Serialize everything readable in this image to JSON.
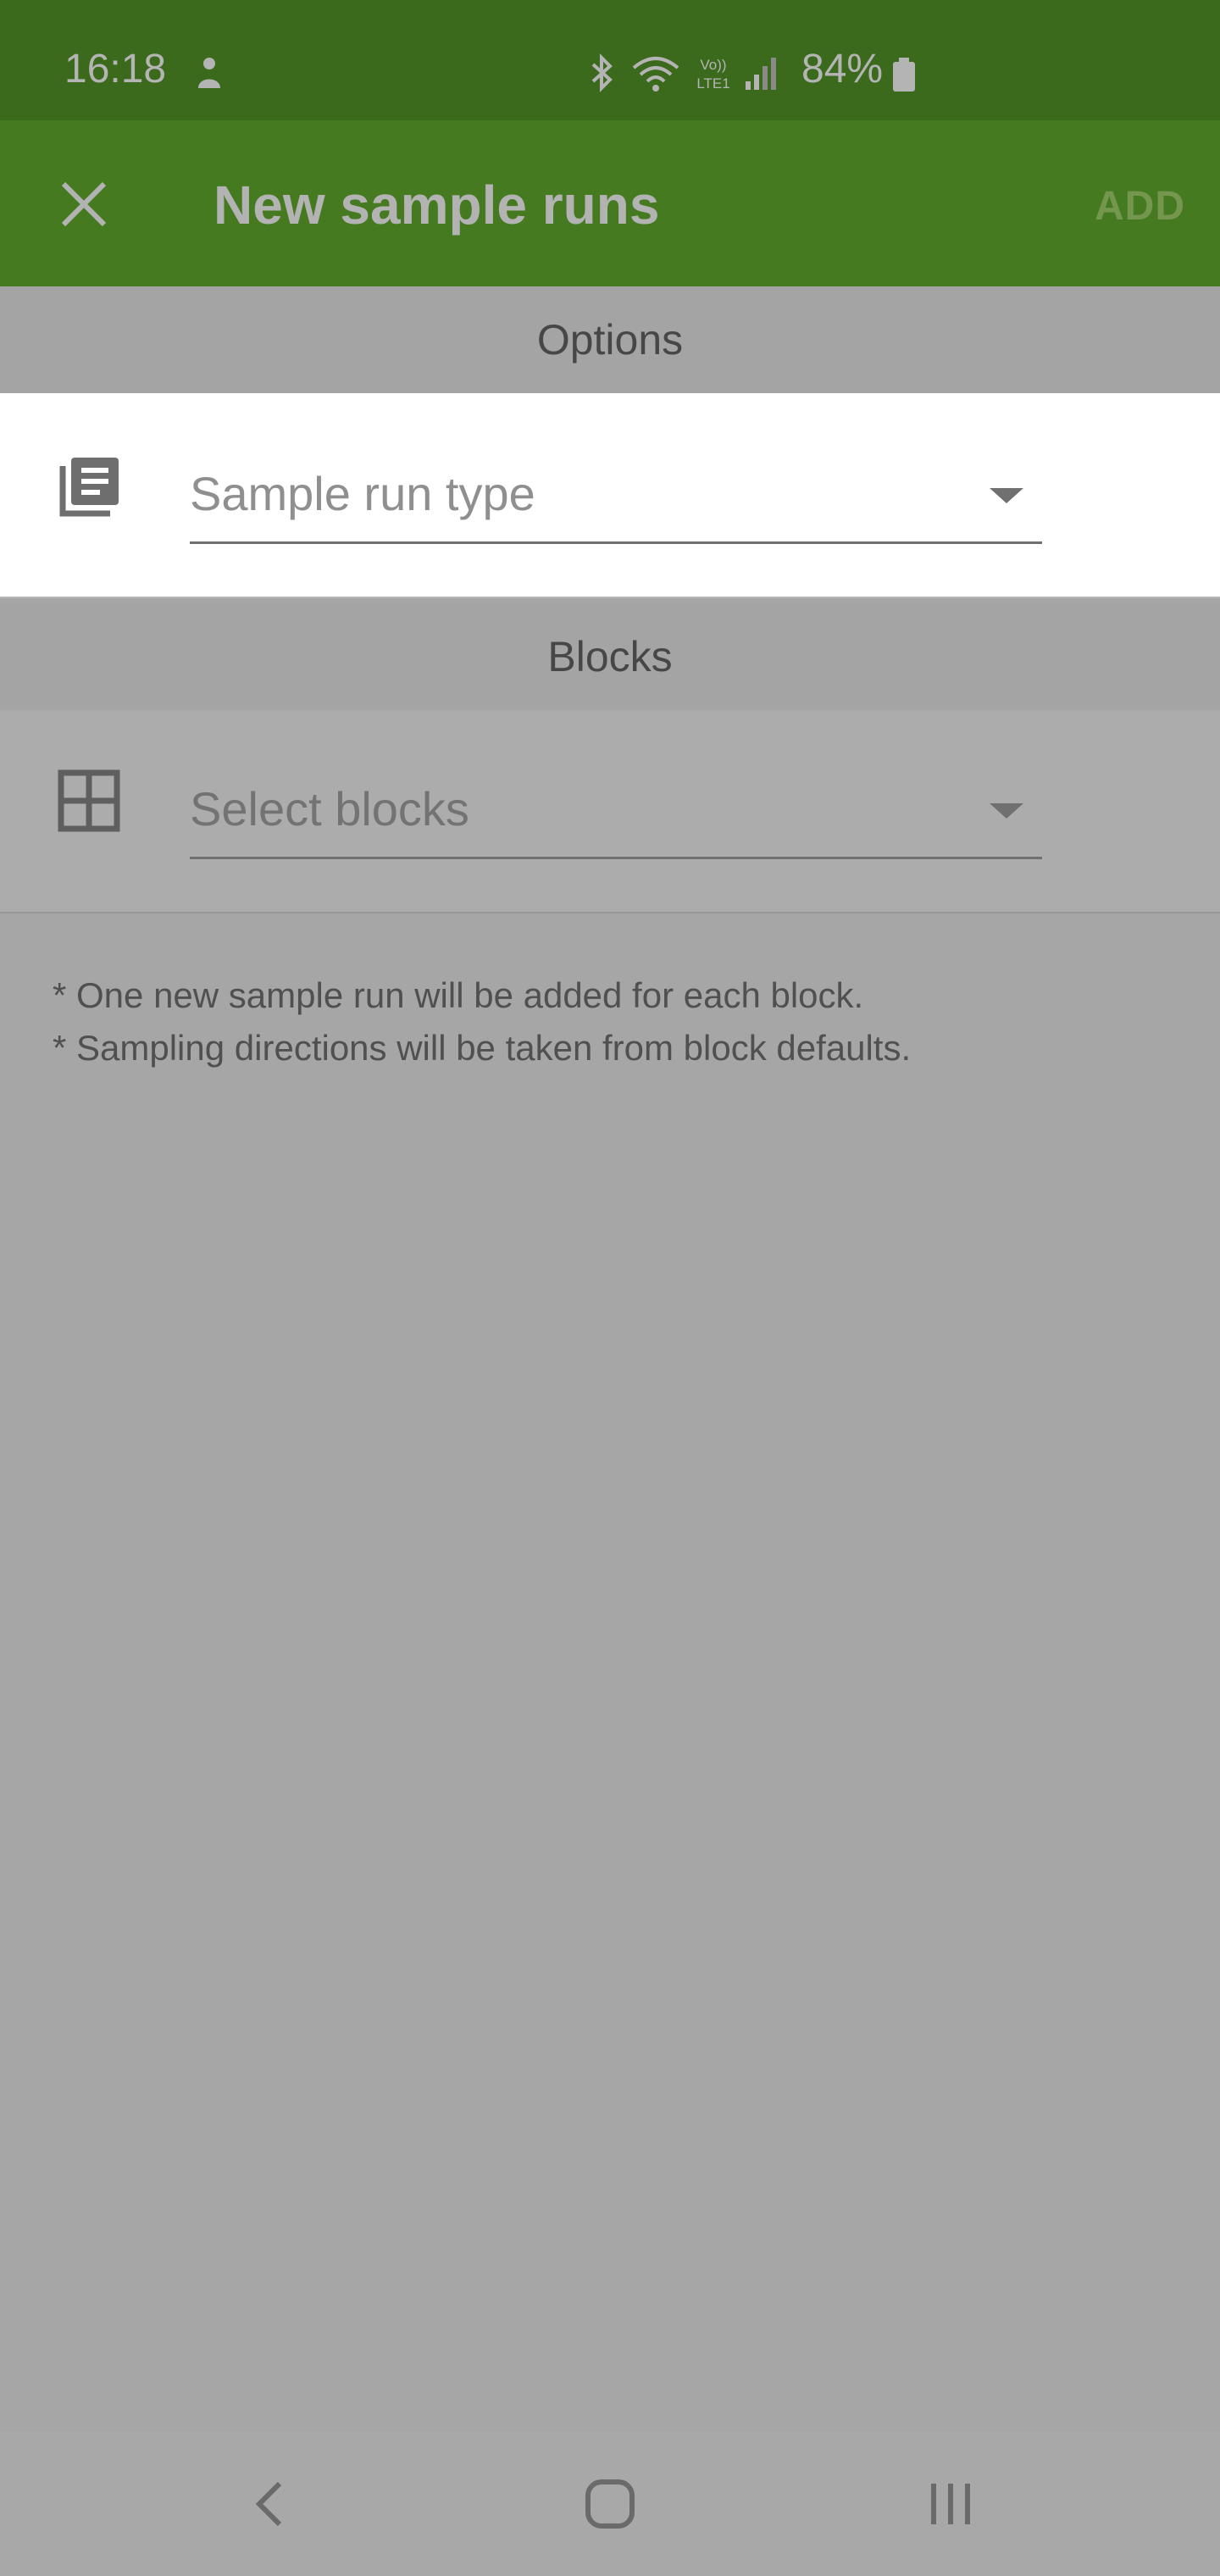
{
  "status_bar": {
    "time": "16:18",
    "battery": "84%",
    "icons": [
      "person-notification-icon",
      "bluetooth-icon",
      "wifi-icon",
      "volte-icon",
      "signal-icon",
      "battery-icon"
    ]
  },
  "app_bar": {
    "title": "New sample runs",
    "add_label": "ADD",
    "close_icon": "close-icon"
  },
  "options": {
    "header": "Options",
    "sample_run_type": {
      "placeholder": "Sample run type",
      "icon": "library-books-icon"
    }
  },
  "blocks": {
    "header": "Blocks",
    "select_blocks": {
      "placeholder": "Select blocks",
      "icon": "grid-icon"
    }
  },
  "notes": [
    "* One new sample run will be added for each block.",
    "* Sampling directions will be taken from block defaults."
  ],
  "nav_bar": {
    "icons": [
      "back-icon",
      "home-icon",
      "recents-icon"
    ]
  },
  "colors": {
    "status_bar": "#3b6a1d",
    "app_bar": "#457a20",
    "overlay_gray": "#a6a6a6",
    "panel_white": "#ffffff"
  }
}
